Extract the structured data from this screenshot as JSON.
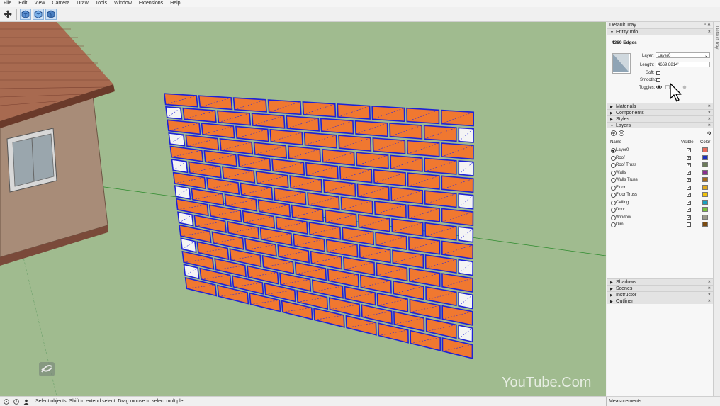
{
  "menu": [
    "File",
    "Edit",
    "View",
    "Camera",
    "Draw",
    "Tools",
    "Window",
    "Extensions",
    "Help"
  ],
  "toolbar": {
    "icons": [
      "move-icon",
      "iso-view-icon",
      "top-view-icon",
      "front-view-icon"
    ]
  },
  "watermark": "YouTube.Com",
  "status": {
    "text": "Select objects. Shift to extend select. Drag mouse to select multiple.",
    "measurements_label": "Measurements"
  },
  "tray": {
    "title": "Default Tray",
    "side_label": "Default Tray",
    "entity_info": {
      "header": "Entity Info",
      "count": "4369 Edges",
      "layer_label": "Layer:",
      "layer_value": "Layer0",
      "length_label": "Length:",
      "length_value": "4669.8814'",
      "soft_label": "Soft:",
      "smooth_label": "Smooth:",
      "toggles_label": "Toggles:"
    },
    "collapsed_top": [
      "Materials",
      "Components",
      "Styles"
    ],
    "layers": {
      "header": "Layers",
      "col_name": "Name",
      "col_visible": "Visible",
      "col_color": "Color",
      "rows": [
        {
          "name": "Layer0",
          "active": true,
          "visible": true,
          "color": "#e86a5a"
        },
        {
          "name": "Roof",
          "active": false,
          "visible": true,
          "color": "#1a2fbf"
        },
        {
          "name": "Roof Truss",
          "active": false,
          "visible": true,
          "color": "#6b7a5a"
        },
        {
          "name": "Walls",
          "active": false,
          "visible": true,
          "color": "#8a2f8f"
        },
        {
          "name": "Walls Truss",
          "active": false,
          "visible": true,
          "color": "#a46a1c"
        },
        {
          "name": "Floor",
          "active": false,
          "visible": true,
          "color": "#e0a81c"
        },
        {
          "name": "Floor Truss",
          "active": false,
          "visible": true,
          "color": "#f0c20a"
        },
        {
          "name": "Ceiling",
          "active": false,
          "visible": true,
          "color": "#1aa0c0"
        },
        {
          "name": "Door",
          "active": false,
          "visible": true,
          "color": "#7ac23a"
        },
        {
          "name": "Window",
          "active": false,
          "visible": true,
          "color": "#9a9a8a"
        },
        {
          "name": "Dim",
          "active": false,
          "visible": false,
          "color": "#7a4a10"
        }
      ]
    },
    "collapsed_bottom": [
      "Shadows",
      "Scenes",
      "Instructor",
      "Outliner"
    ]
  }
}
